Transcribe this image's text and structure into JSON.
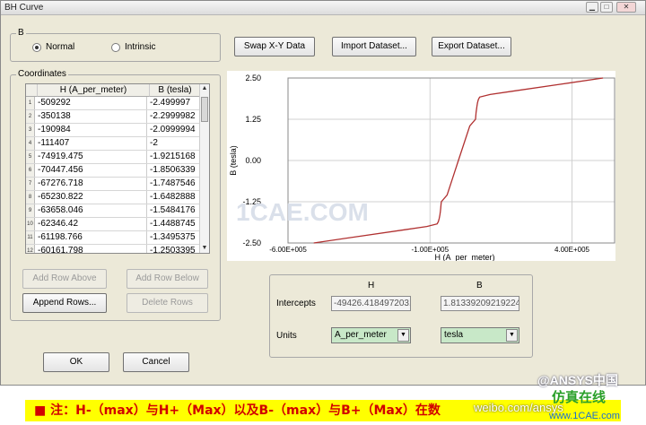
{
  "window": {
    "title": "BH Curve"
  },
  "b_group": {
    "label": "B",
    "normal": "Normal",
    "intrinsic": "Intrinsic",
    "selected": "Normal"
  },
  "toolbar": {
    "swap": "Swap X-Y Data",
    "import": "Import Dataset...",
    "export": "Export Dataset..."
  },
  "coordinates": {
    "label": "Coordinates",
    "col_h": "H (A_per_meter)",
    "col_b": "B (tesla)",
    "rows": [
      {
        "n": "1",
        "h": "-509292",
        "b": "-2.499997"
      },
      {
        "n": "2",
        "h": "-350138",
        "b": "-2.2999982"
      },
      {
        "n": "3",
        "h": "-190984",
        "b": "-2.0999994"
      },
      {
        "n": "4",
        "h": "-111407",
        "b": "-2"
      },
      {
        "n": "5",
        "h": "-74919.475",
        "b": "-1.9215168"
      },
      {
        "n": "6",
        "h": "-70447.456",
        "b": "-1.8506339"
      },
      {
        "n": "7",
        "h": "-67276.718",
        "b": "-1.7487546"
      },
      {
        "n": "8",
        "h": "-65230.822",
        "b": "-1.6482888"
      },
      {
        "n": "9",
        "h": "-63658.046",
        "b": "-1.5484176"
      },
      {
        "n": "10",
        "h": "-62346.42",
        "b": "-1.4488745"
      },
      {
        "n": "11",
        "h": "-61198.766",
        "b": "-1.3495375"
      },
      {
        "n": "12",
        "h": "-60161.798",
        "b": "-1.2503395"
      }
    ],
    "add_above": "Add Row Above",
    "add_below": "Add Row Below",
    "append": "Append Rows...",
    "delete": "Delete Rows"
  },
  "chart_data": {
    "type": "line",
    "xlabel": "H (A_per_meter)",
    "ylabel": "B (tesla)",
    "xlim": [
      -600000,
      550000
    ],
    "ylim": [
      -2.5,
      2.5
    ],
    "x_ticks": [
      "-6.00E+005",
      "-1.00E+005",
      "4.00E+005"
    ],
    "x_tick_values": [
      -600000,
      -100000,
      400000
    ],
    "y_ticks": [
      "2.50",
      "1.25",
      "0.00",
      "-1.25",
      "-2.50"
    ],
    "y_tick_values": [
      2.5,
      1.25,
      0,
      -1.25,
      -2.5
    ],
    "series": [
      {
        "color": "#b03030",
        "x": [
          -509292,
          -350138,
          -190984,
          -111407,
          -74919,
          -70447,
          -67277,
          -65231,
          -63658,
          -62346,
          -61199,
          -60162,
          -40000,
          0,
          40000,
          60162,
          61199,
          62346,
          63658,
          65231,
          67277,
          70447,
          74919,
          111407,
          190984,
          350138,
          509292
        ],
        "y": [
          -2.5,
          -2.3,
          -2.1,
          -2.0,
          -1.92,
          -1.85,
          -1.75,
          -1.65,
          -1.55,
          -1.45,
          -1.35,
          -1.25,
          -1.05,
          0,
          1.05,
          1.25,
          1.35,
          1.45,
          1.55,
          1.65,
          1.75,
          1.85,
          1.92,
          2.0,
          2.1,
          2.3,
          2.5
        ]
      }
    ],
    "grid": true
  },
  "intercepts": {
    "col_h": "H",
    "col_b": "B",
    "label": "Intercepts",
    "h_value": "-49426.4184972031",
    "b_value": "1.81339209219224",
    "units_label": "Units",
    "h_unit": "A_per_meter",
    "b_unit": "tesla"
  },
  "footer": {
    "ok": "OK",
    "cancel": "Cancel"
  },
  "banner": {
    "text": "■  注：H-（max）与H+（Max）以及B-（max）与B+（Max）在数"
  },
  "watermarks": {
    "main": "1CAE.COM",
    "brand": "@ANSYS中国",
    "weibo": "weibo.com/ansys",
    "site": "仿真在线",
    "url": "www.1CAE.com"
  }
}
